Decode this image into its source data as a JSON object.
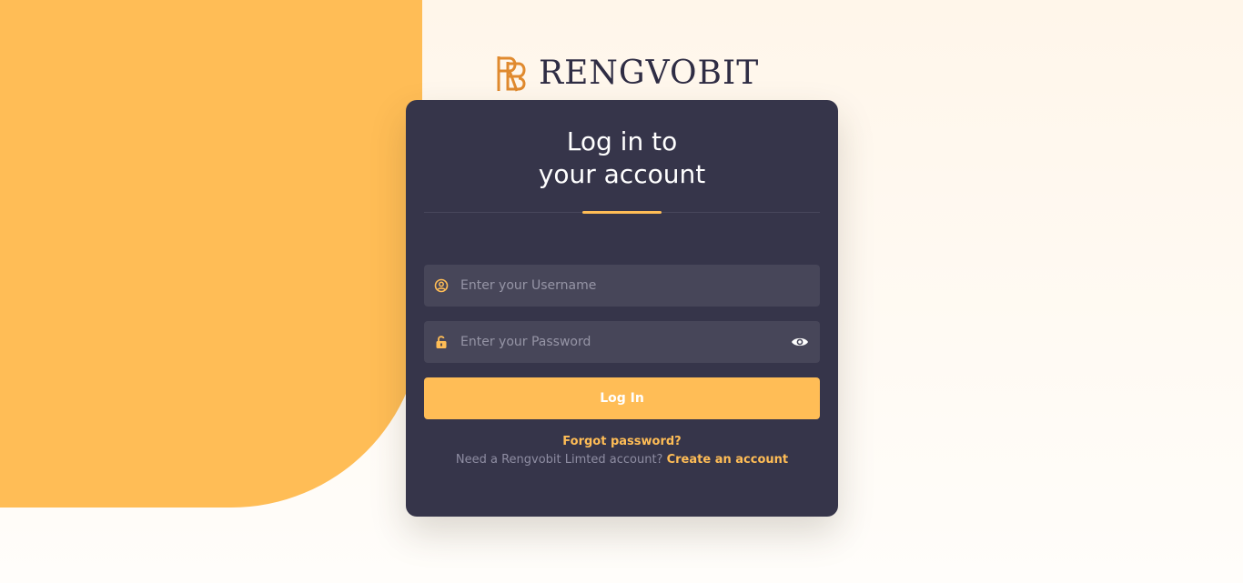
{
  "brand": {
    "name": "RENGVOBIT",
    "logo_icon": "rb-monogram-icon",
    "accent_color": "#ffbd56",
    "card_color": "#36354a"
  },
  "login": {
    "title_line1": "Log in to",
    "title_line2": "your account",
    "username_placeholder": "Enter your Username",
    "username_icon": "user-circle-icon",
    "password_placeholder": "Enter your Password",
    "password_icon": "unlock-icon",
    "show_password_icon": "eye-icon",
    "submit_label": "Log In",
    "forgot_label": "Forgot password?",
    "signup_prompt": "Need a Rengvobit Limted account?",
    "signup_link": "Create an account"
  }
}
